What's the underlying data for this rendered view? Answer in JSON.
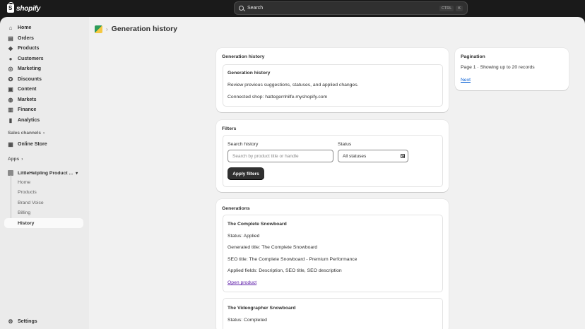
{
  "topbar": {
    "brand": "shopify",
    "search_label": "Search",
    "shortcut_key1": "CTRL",
    "shortcut_key2": "K"
  },
  "sidebar": {
    "items": [
      {
        "label": "Home",
        "icon": "home-icon"
      },
      {
        "label": "Orders",
        "icon": "orders-icon"
      },
      {
        "label": "Products",
        "icon": "tag-icon"
      },
      {
        "label": "Customers",
        "icon": "person-icon"
      },
      {
        "label": "Marketing",
        "icon": "target-icon"
      },
      {
        "label": "Discounts",
        "icon": "discount-icon"
      },
      {
        "label": "Content",
        "icon": "content-icon"
      },
      {
        "label": "Markets",
        "icon": "globe-icon"
      },
      {
        "label": "Finance",
        "icon": "bank-icon"
      },
      {
        "label": "Analytics",
        "icon": "chart-icon"
      }
    ],
    "sales_channels_label": "Sales channels",
    "online_store_label": "Online Store",
    "apps_label": "Apps",
    "app_name": "LittleHelpling Product ...",
    "app_subitems": [
      "Home",
      "Products",
      "Brand Voice",
      "Billing",
      "History"
    ],
    "settings_label": "Settings"
  },
  "page": {
    "title": "Generation history"
  },
  "history_card": {
    "title": "Generation history",
    "inner_title": "Generation history",
    "description": "Review previous suggestions, statuses, and applied changes.",
    "connected_shop": "Connected shop: hattegernhilfe.myshopify.com"
  },
  "filters": {
    "title": "Filters",
    "search_label": "Search history",
    "search_placeholder": "Search by product title or handle",
    "status_label": "Status",
    "status_value": "All statuses",
    "apply_label": "Apply filters"
  },
  "generations": {
    "title": "Generations",
    "items": [
      {
        "name": "The Complete Snowboard",
        "status": "Status: Applied",
        "generated_title": "Generated title: The Complete Snowboard",
        "seo_title": "SEO title: The Complete Snowboard - Premium Performance",
        "applied_fields": "Applied fields: Description, SEO title, SEO description",
        "link": "Open product"
      },
      {
        "name": "The Videographer Snowboard",
        "status": "Status: Completed"
      }
    ]
  },
  "pagination": {
    "title": "Pagination",
    "info": "Page 1 · Showing up to 20 records",
    "next_label": "Next"
  },
  "colors": {
    "topbar": "#1a1a1a",
    "sidebar": "#ebebeb",
    "main": "#f1f1f1",
    "button_dark": "#303030",
    "link_visited": "#5c1aa8",
    "link_blue": "#005bd3"
  }
}
